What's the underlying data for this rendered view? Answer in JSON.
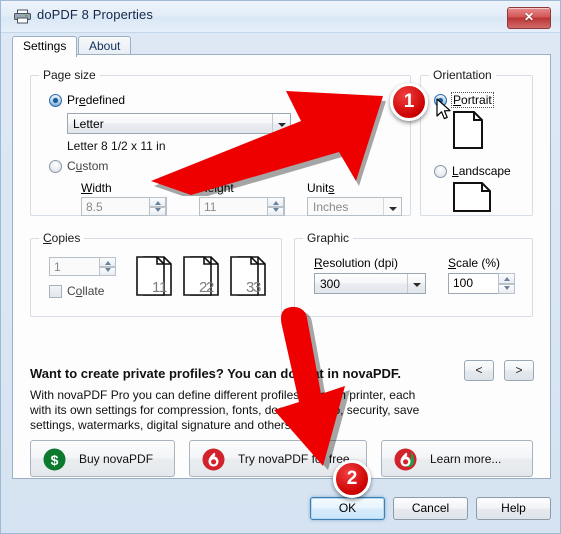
{
  "window": {
    "title": "doPDF 8 Properties",
    "icon": "printer-icon",
    "close_label": "✕"
  },
  "tabs": [
    {
      "label": "Settings",
      "active": true
    },
    {
      "label": "About",
      "active": false
    }
  ],
  "page_size": {
    "group_label": "Page size",
    "predefined_label": "Predefined",
    "predefined_selected": true,
    "predefined_value": "Letter",
    "dimensions_text": "Letter 8 1/2 x 11 in",
    "custom_label": "Custom",
    "custom_selected": false,
    "width_label": "Width",
    "width_value": "8.5",
    "height_label": "Height",
    "height_value": "11",
    "units_label": "Units",
    "units_value": "Inches"
  },
  "orientation": {
    "group_label": "Orientation",
    "portrait_label": "Portrait",
    "portrait_selected": true,
    "landscape_label": "Landscape",
    "landscape_selected": false
  },
  "copies": {
    "group_label": "Copies",
    "count_value": "1",
    "collate_label": "Collate",
    "collate_checked": false,
    "sheet_numbers": [
      "1",
      "2",
      "3"
    ]
  },
  "graphic": {
    "group_label": "Graphic",
    "resolution_label": "Resolution (dpi)",
    "resolution_value": "300",
    "scale_label": "Scale (%)",
    "scale_value": "100"
  },
  "promo": {
    "headline": "Want to create private profiles? You can do that in novaPDF.",
    "body": "With novaPDF Pro you can define different profiles for each printer, each with its own settings for compression, fonts, document info, security, save settings, watermarks, digital signature and others.",
    "prev_label": "<",
    "next_label": ">",
    "buttons": [
      {
        "label": "Buy novaPDF",
        "icon": "dollar-circle-icon"
      },
      {
        "label": "Try novaPDF for free",
        "icon": "novapdf-drop-icon"
      },
      {
        "label": "Learn more...",
        "icon": "novapdf-drop-icon"
      }
    ]
  },
  "dialog_buttons": {
    "ok": "OK",
    "cancel": "Cancel",
    "help": "Help"
  },
  "annotations": {
    "badge_one": "1",
    "badge_two": "2",
    "accent_color": "#ee0000"
  }
}
